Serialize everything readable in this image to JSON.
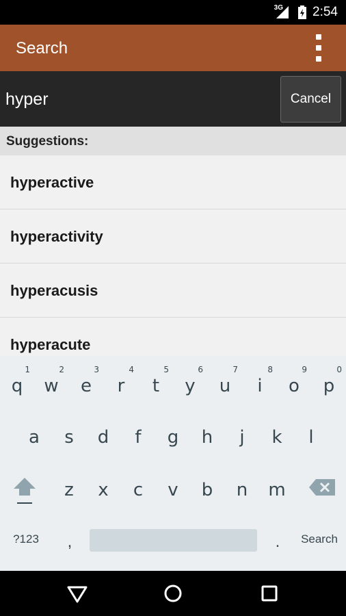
{
  "status_bar": {
    "network": "3G",
    "time": "2:54",
    "icons": [
      "signal-icon",
      "battery-icon"
    ]
  },
  "app_bar": {
    "title": "Search",
    "overflow_icon": "overflow-menu-icon"
  },
  "search": {
    "value": "hyper",
    "cancel_label": "Cancel"
  },
  "suggestions": {
    "header": "Suggestions:",
    "items": [
      "hyperactive",
      "hyperactivity",
      "hyperacusis",
      "hyperacute"
    ]
  },
  "keyboard": {
    "row1": [
      {
        "key": "q",
        "hint": "1"
      },
      {
        "key": "w",
        "hint": "2"
      },
      {
        "key": "e",
        "hint": "3"
      },
      {
        "key": "r",
        "hint": "4"
      },
      {
        "key": "t",
        "hint": "5"
      },
      {
        "key": "y",
        "hint": "6"
      },
      {
        "key": "u",
        "hint": "7"
      },
      {
        "key": "i",
        "hint": "8"
      },
      {
        "key": "o",
        "hint": "9"
      },
      {
        "key": "p",
        "hint": "0"
      }
    ],
    "row2": [
      "a",
      "s",
      "d",
      "f",
      "g",
      "h",
      "j",
      "k",
      "l"
    ],
    "row3": [
      "z",
      "x",
      "c",
      "v",
      "b",
      "n",
      "m"
    ],
    "symbols_label": "?123",
    "comma": ",",
    "period": ".",
    "search_label": "Search",
    "icons": [
      "shift-icon",
      "backspace-icon"
    ]
  },
  "nav_bar": {
    "icons": [
      "back-icon",
      "home-icon",
      "recents-icon"
    ]
  },
  "colors": {
    "app_bar": "#a0532b",
    "search_bar": "#262626",
    "keyboard": "#eceff1",
    "key_text": "#37474f"
  }
}
